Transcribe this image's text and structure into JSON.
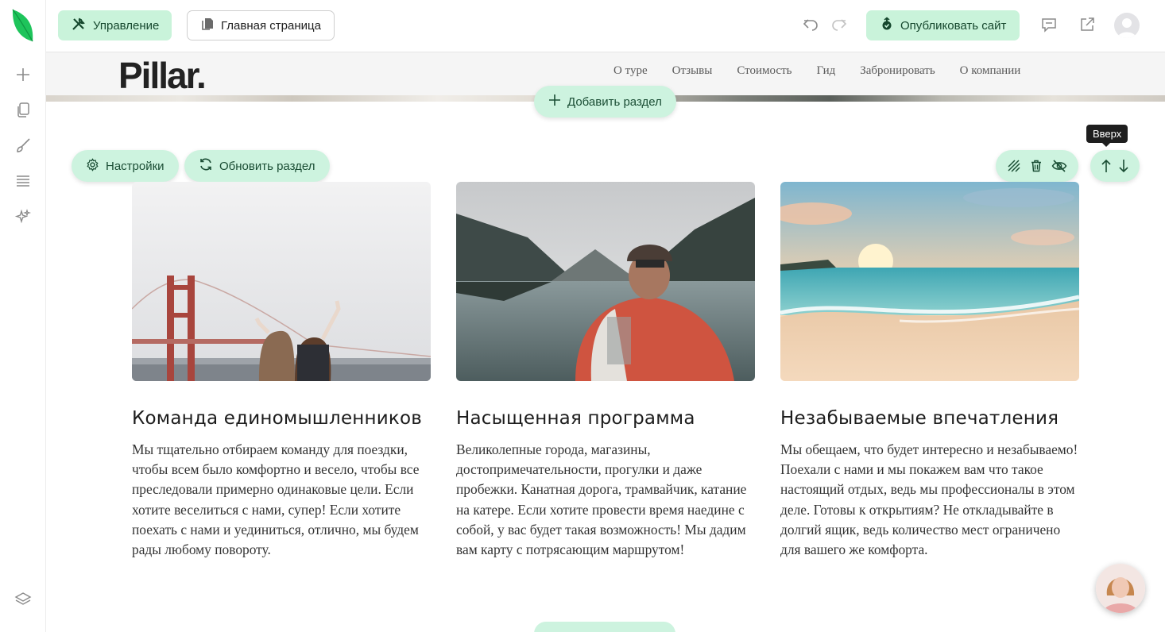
{
  "toolbar": {
    "manage_label": "Управление",
    "page_label": "Главная страница",
    "publish_label": "Опубликовать сайт"
  },
  "icons": {
    "logo": "leaf-logo",
    "rail": [
      "plus-icon",
      "pages-icon",
      "brush-icon",
      "layers-list-icon",
      "sparkles-icon",
      "stack-icon"
    ],
    "top": [
      "undo-icon",
      "redo-icon",
      "comment-icon",
      "external-link-icon",
      "user-avatar"
    ]
  },
  "site": {
    "brand": "Pillar.",
    "nav": [
      "О туре",
      "Отзывы",
      "Стоимость",
      "Гид",
      "Забронировать",
      "О компании"
    ]
  },
  "editor": {
    "add_section": "Добавить раздел",
    "settings": "Настройки",
    "refresh_section": "Обновить раздел",
    "tooltip": "Вверх"
  },
  "cards": [
    {
      "title": "Команда единомышленников",
      "text": "Мы тщательно отбираем команду для поездки, чтобы всем было комфортно и весело, чтобы все преследовали примерно одинаковые цели. Если хотите веселиться с нами, супер! Если хотите поехать с нами и уединиться, отлично, мы будем рады любому повороту."
    },
    {
      "title": "Насыщенная программа",
      "text": "Великолепные города, магазины, достопримечательности, прогулки и даже пробежки. Канатная дорога, трамвайчик, катание на катере. Если хотите провести время наедине с собой, у вас будет такая возможность! Мы дадим вам карту с потрясающим маршрутом!"
    },
    {
      "title": "Незабываемые впечатления",
      "text": "Мы обещаем, что будет интересно и незабываемо! Поехали с нами и мы покажем вам что такое настоящий отдых, ведь мы профессионалы в этом деле. Готовы к открытиям? Не откладывайте в долгий ящик, ведь количество мест ограничено для вашего же комфорта."
    }
  ],
  "colors": {
    "accent": "#c9f3da",
    "accent_text": "#15472d",
    "logo_green": "#22c55e"
  }
}
